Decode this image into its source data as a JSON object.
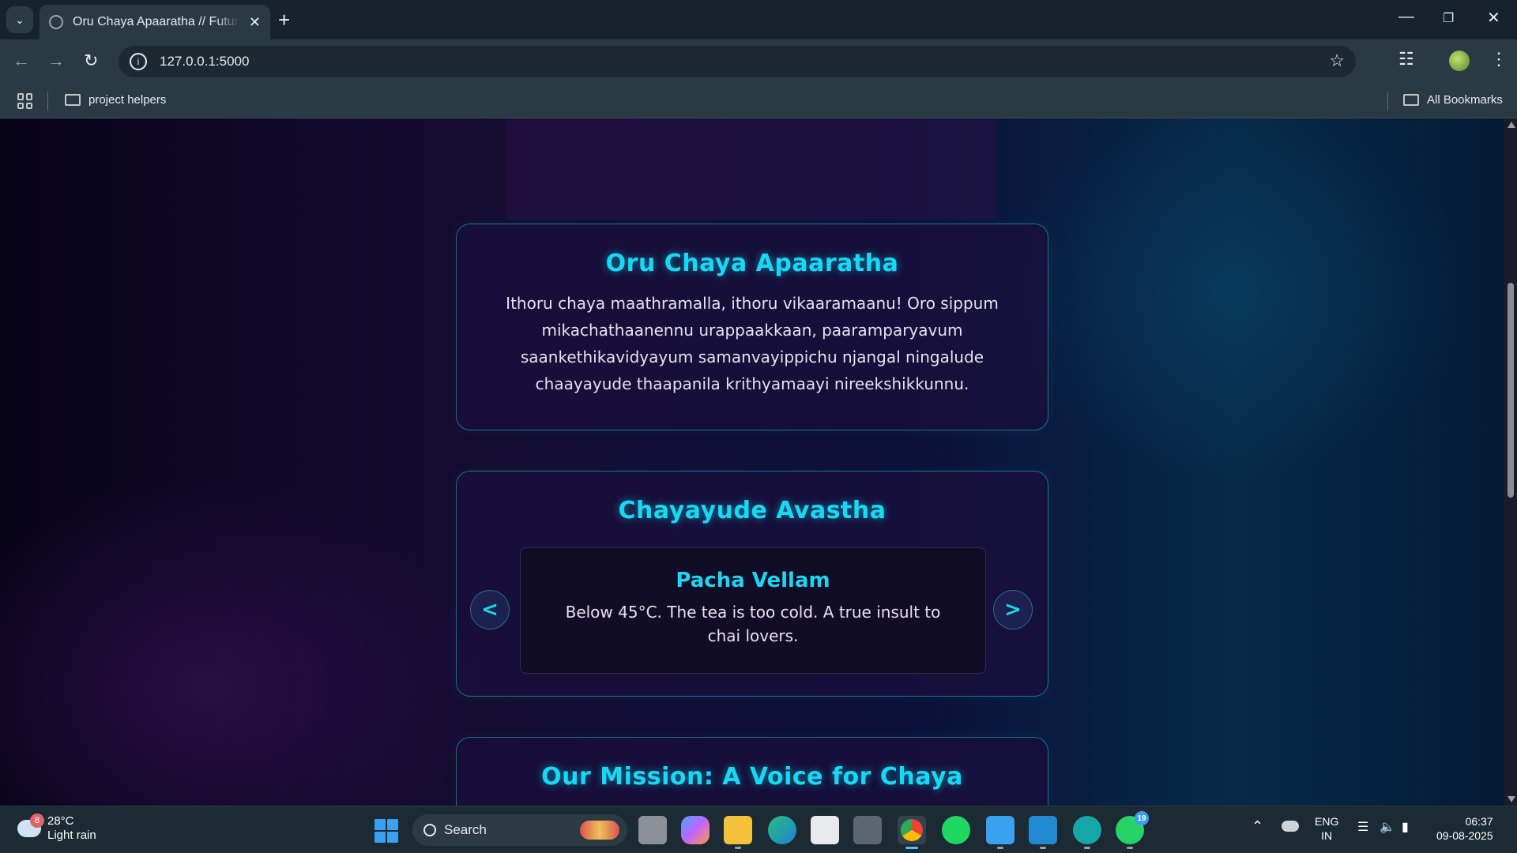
{
  "browser": {
    "tab_title": "Oru Chaya Apaaratha // Futuristic",
    "url": "127.0.0.1:5000",
    "bookmarks": [
      {
        "label": "project helpers"
      }
    ],
    "all_bookmarks_label": "All Bookmarks"
  },
  "page": {
    "about": {
      "title": "Oru Chaya Apaaratha",
      "body": "Ithoru chaya maathramalla, ithoru vikaaramaanu! Oro sippum mikachathaanennu urappaakkaan, paaramparyavum saankethikavidyayum samanvayippichu njangal ningalude chaayayude thaapanila krithyamaayi nireekshikkunnu."
    },
    "status": {
      "title": "Chayayude Avastha",
      "state_name": "Pacha Vellam",
      "state_desc": "Below 45°C. The tea is too cold. A true insult to chai lovers.",
      "prev_label": "<",
      "next_label": ">"
    },
    "mission": {
      "title": "Our Mission: A Voice for Chaya"
    }
  },
  "taskbar": {
    "weather_temp": "28°C",
    "weather_desc": "Light rain",
    "weather_badge": "8",
    "search_label": "Search",
    "whatsapp_badge": "19",
    "lang_top": "ENG",
    "lang_bottom": "IN",
    "time": "06:37",
    "date": "09-08-2025"
  },
  "colors": {
    "accent": "#19d8f2",
    "card_border": "#1d6f86"
  }
}
